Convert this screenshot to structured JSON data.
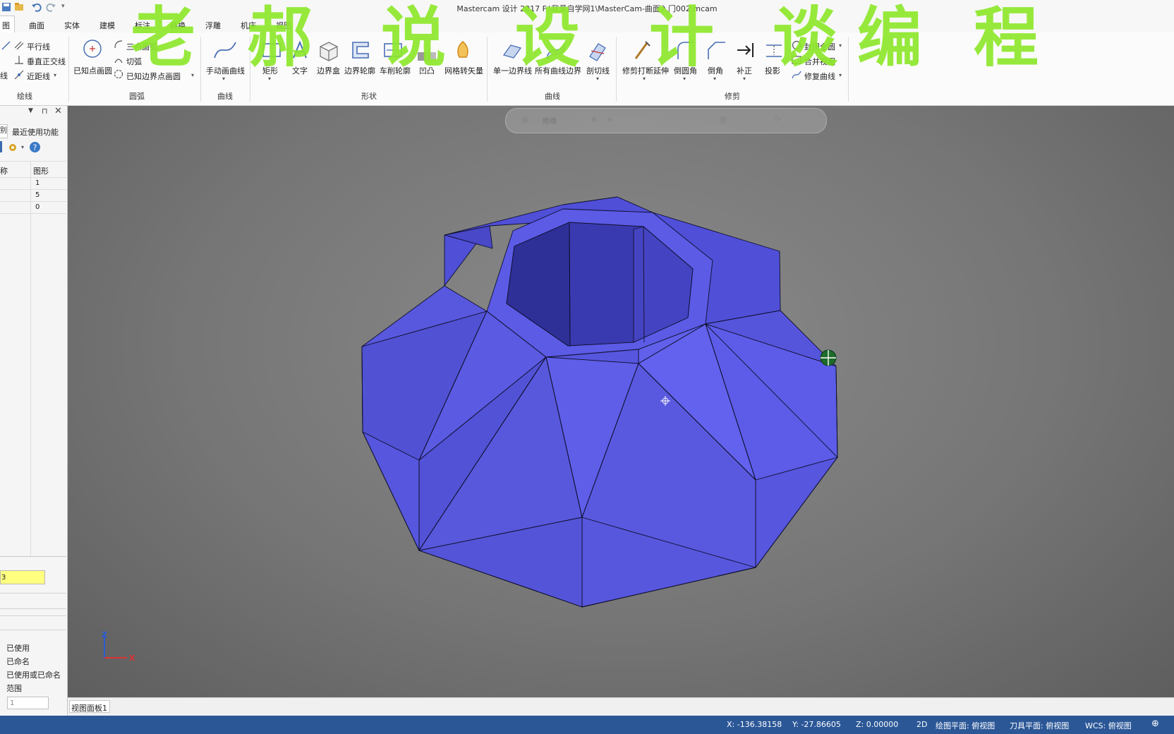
{
  "window": {
    "title": "Mastercam 设计 2017  F:\\我爱自学网1\\MasterCam-曲面入门002.mcam"
  },
  "tabs": [
    {
      "label": "草图",
      "visible": "图",
      "active": true
    },
    {
      "label": "曲面"
    },
    {
      "label": "实体"
    },
    {
      "label": "建模"
    },
    {
      "label": "标注"
    },
    {
      "label": "转换"
    },
    {
      "label": "浮雕"
    },
    {
      "label": "机床"
    },
    {
      "label": "视图"
    }
  ],
  "ribbon": {
    "lines_group": {
      "items": [
        "平行线",
        "垂直正交线",
        "近距线"
      ],
      "partial": "线",
      "label": "绘线"
    },
    "arcs_group": {
      "big_button": "已知点画圆",
      "items": [
        "三点画弧",
        "切弧",
        "已知边界点画圆"
      ],
      "label": "圆弧"
    },
    "curve_group": {
      "big_button": "手动画曲线",
      "label": "曲线"
    },
    "shape_group": {
      "buttons": [
        "矩形",
        "文字",
        "边界盒",
        "边界轮廓",
        "车削轮廓",
        "凹凸",
        "网格转矢量"
      ],
      "label": "形状"
    },
    "curves_group": {
      "buttons": [
        "单一边界线",
        "所有曲线边界",
        "剖切线"
      ],
      "label": "曲线"
    },
    "trim_group": {
      "buttons": [
        "修剪打断延伸",
        "倒圆角",
        "倒角",
        "补正",
        "投影"
      ],
      "small_items": [
        "封闭全圆",
        "合并视图",
        "修复曲线"
      ],
      "label": "修剪"
    }
  },
  "left_panel": {
    "tabs": [
      "别",
      "最近使用功能"
    ],
    "columns": [
      "称",
      "图形"
    ],
    "rows": [
      "1",
      "5",
      "0"
    ],
    "input_value": "3",
    "radio_options": [
      "已使用",
      "已命名",
      "已使用或已命名",
      "范围"
    ],
    "range_value": "1"
  },
  "viewport": {
    "mini_toolbar_label": "绝缘",
    "axis_labels": {
      "z": "Z",
      "x": "X"
    }
  },
  "bottom_tab": {
    "label": "视图面板1"
  },
  "status": {
    "x": "X:   -136.38158",
    "y": "Y:   -27.86605",
    "z": "Z:   0.00000",
    "mode": "2D",
    "cplane": "绘图平面: 俯视图",
    "tplane": "刀具平面: 俯视图",
    "wcs": "WCS: 俯视图"
  },
  "watermark": {
    "chars": [
      "老",
      "郝",
      "说",
      "设",
      "计",
      "谈",
      "编",
      "程"
    ]
  },
  "colors": {
    "solid_fill": "#5a5ae6",
    "status_bar": "#2b5797",
    "watermark": "#8ee82c",
    "highlight_input": "#ffff80"
  }
}
